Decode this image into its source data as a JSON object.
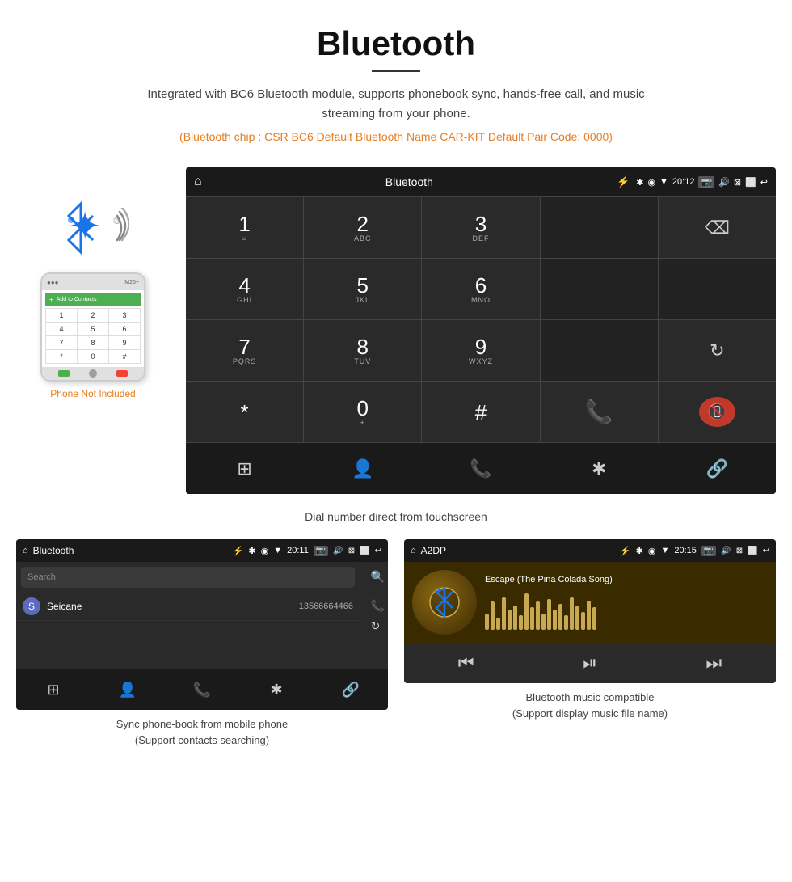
{
  "title": "Bluetooth",
  "description": "Integrated with BC6 Bluetooth module, supports phonebook sync, hands-free call, and music streaming from your phone.",
  "specs": "(Bluetooth chip : CSR BC6    Default Bluetooth Name CAR-KIT    Default Pair Code: 0000)",
  "phone_not_included": "Phone Not Included",
  "dial_caption": "Dial number direct from touchscreen",
  "phonebook_caption": "Sync phone-book from mobile phone\n(Support contacts searching)",
  "music_caption": "Bluetooth music compatible\n(Support display music file name)",
  "android_dial": {
    "status_bar": {
      "home_icon": "⌂",
      "title": "Bluetooth",
      "usb_icon": "⚡",
      "time": "20:12",
      "icons": [
        "📷",
        "🔊",
        "⊠",
        "⬜",
        "↩"
      ]
    },
    "keypad": [
      {
        "num": "1",
        "letters": "∞",
        "col": 1
      },
      {
        "num": "2",
        "letters": "ABC",
        "col": 2
      },
      {
        "num": "3",
        "letters": "DEF",
        "col": 3
      },
      {
        "num": "4",
        "letters": "GHI",
        "col": 1
      },
      {
        "num": "5",
        "letters": "JKL",
        "col": 2
      },
      {
        "num": "6",
        "letters": "MNO",
        "col": 3
      },
      {
        "num": "7",
        "letters": "PQRS",
        "col": 1
      },
      {
        "num": "8",
        "letters": "TUV",
        "col": 2
      },
      {
        "num": "9",
        "letters": "WXYZ",
        "col": 3
      },
      {
        "num": "*",
        "letters": "",
        "col": 1
      },
      {
        "num": "0",
        "letters": "+",
        "col": 2
      },
      {
        "num": "#",
        "letters": "",
        "col": 3
      }
    ],
    "bottom_nav": [
      "⊞",
      "👤",
      "📞",
      "✱",
      "🔗"
    ]
  },
  "phonebook_screen": {
    "status": {
      "home": "⌂",
      "title": "Bluetooth",
      "time": "20:11"
    },
    "search_placeholder": "Search",
    "contact": {
      "letter": "S",
      "name": "Seicane",
      "number": "13566664466"
    },
    "right_icons": [
      "🔍",
      "📞",
      "↻"
    ],
    "nav_icons": [
      "⊞",
      "👤",
      "📞",
      "✱",
      "🔗"
    ]
  },
  "music_screen": {
    "status": {
      "home": "⌂",
      "title": "A2DP",
      "time": "20:15"
    },
    "song_title": "Escape (The Pina Colada Song)",
    "bt_icon": "✱",
    "controls": [
      "⏮",
      "⏯",
      "⏭"
    ],
    "viz_heights": [
      20,
      35,
      15,
      40,
      25,
      30,
      18,
      45,
      28,
      35,
      20,
      38,
      25,
      32,
      18,
      40,
      30,
      22,
      36,
      28
    ]
  },
  "colors": {
    "accent_orange": "#e67e22",
    "android_bg": "#2a2a2a",
    "android_dark": "#1a1a1a",
    "green_call": "#4caf50",
    "red_call": "#c0392b",
    "blue_bt": "#1a73e8"
  }
}
